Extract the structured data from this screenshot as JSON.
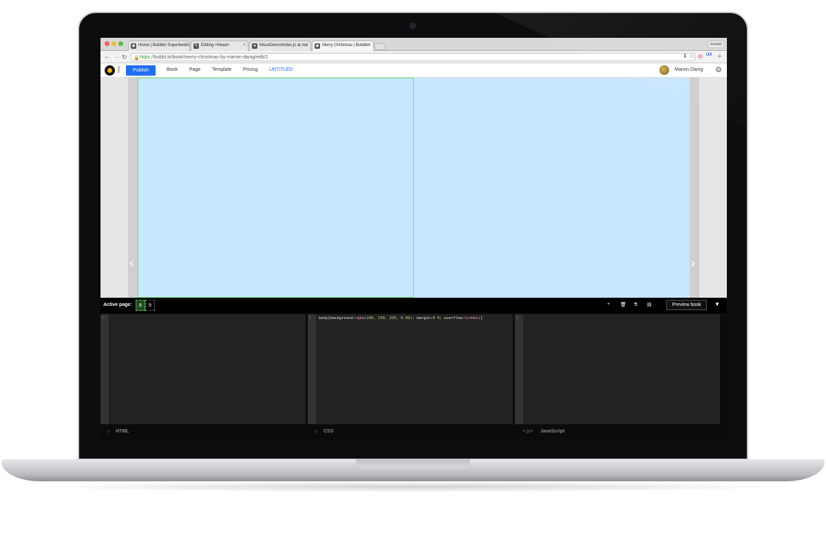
{
  "browser": {
    "tabs": [
      {
        "title": "Home | Bubblin Superbooks"
      },
      {
        "title": "Editing <Head>"
      },
      {
        "title": "MoonDemo/index.js at ma"
      },
      {
        "title": "Merry Christmas | Bubblin"
      }
    ],
    "user": "Arvind",
    "url_scheme": "https://",
    "url_rest": "bubbl.in/book/merry-christmas-by-marvin-danig/edit/2"
  },
  "app": {
    "beta": "beta",
    "publish_label": "Publish",
    "menu": [
      "Book",
      "Page",
      "Template",
      "Pricing"
    ],
    "untitled": "UNTITLED",
    "username": "Marvin Danig"
  },
  "toolbar": {
    "active_label": "Active page:",
    "pages": [
      "8",
      "9"
    ],
    "preview_label": "Preview book"
  },
  "editors": {
    "html": {
      "line": "1",
      "code": ""
    },
    "css": {
      "line": "1",
      "code_prefix": "body{background:",
      "code_fn": "rgba",
      "code_args": "(200, 230, 255, 0.99)",
      "code_mid": "; margin:",
      "code_num": "0 0",
      "code_mid2": "; overflow:",
      "code_kw": "hidden",
      "code_end": ";}"
    },
    "js": {
      "line": "1",
      "code": ""
    }
  },
  "footer": {
    "html_label": "HTML",
    "css_label": "CSS",
    "js_tag": "<.js>",
    "js_label": "JavaScript"
  },
  "colors": {
    "page_bg": "#c8e6ff",
    "publish": "#1f6ff2",
    "active_page": "#1f4d1f"
  }
}
